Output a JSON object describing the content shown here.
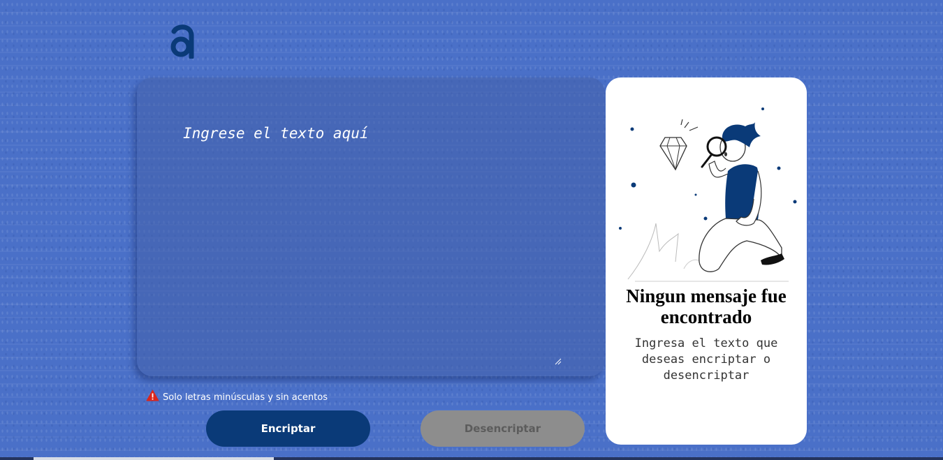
{
  "logo": {
    "icon": "alura-logo-icon",
    "color": "#0a3a78"
  },
  "input": {
    "placeholder": "Ingrese el texto aquí",
    "value": ""
  },
  "warning": {
    "icon": "warning-triangle-icon",
    "text": "Solo letras minúsculas y sin acentos",
    "icon_color": "#d9261c"
  },
  "buttons": {
    "encrypt": "Encriptar",
    "decrypt": "Desencriptar"
  },
  "result": {
    "illustration": "person-magnifying-glass-diamond-illustration",
    "title": "Ningun mensaje fue encontrado",
    "message": "Ingresa el texto que deseas encriptar o desencriptar"
  },
  "colors": {
    "background": "#4a70c8",
    "primary": "#0a3a78",
    "disabled": "#8d8d8d",
    "card": "#ffffff"
  }
}
